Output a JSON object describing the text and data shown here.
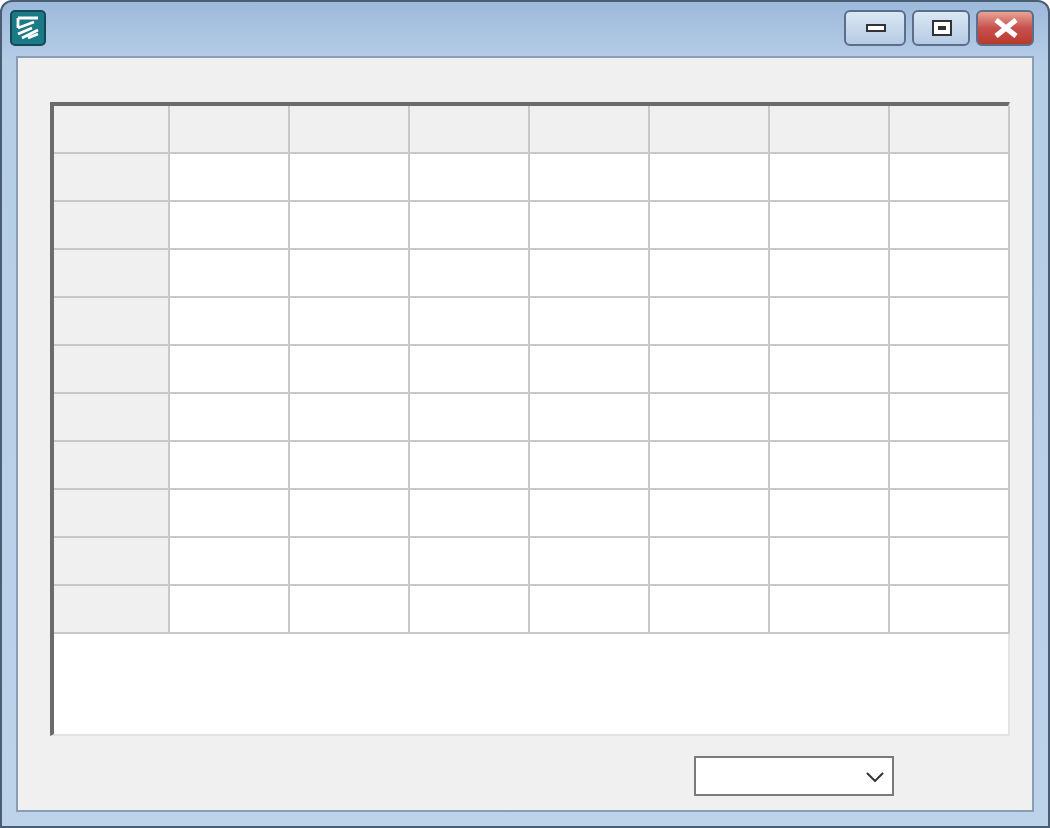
{
  "window": {
    "buttons": [
      {
        "kind": "minimize"
      },
      {
        "kind": "maximize"
      },
      {
        "kind": "close"
      }
    ]
  },
  "grid": {
    "columns": [
      {
        "kind": "row-header"
      },
      {
        "kind": "data"
      },
      {
        "kind": "data"
      },
      {
        "kind": "data"
      },
      {
        "kind": "data"
      },
      {
        "kind": "data"
      },
      {
        "kind": "data"
      },
      {
        "kind": "data"
      }
    ],
    "rows": [
      {
        "kind": "header"
      },
      {
        "kind": "data"
      },
      {
        "kind": "data"
      },
      {
        "kind": "data"
      },
      {
        "kind": "data"
      },
      {
        "kind": "data"
      },
      {
        "kind": "data"
      },
      {
        "kind": "data"
      },
      {
        "kind": "data"
      },
      {
        "kind": "data"
      },
      {
        "kind": "data"
      }
    ]
  },
  "dropdown": {
    "kind": "combo"
  }
}
